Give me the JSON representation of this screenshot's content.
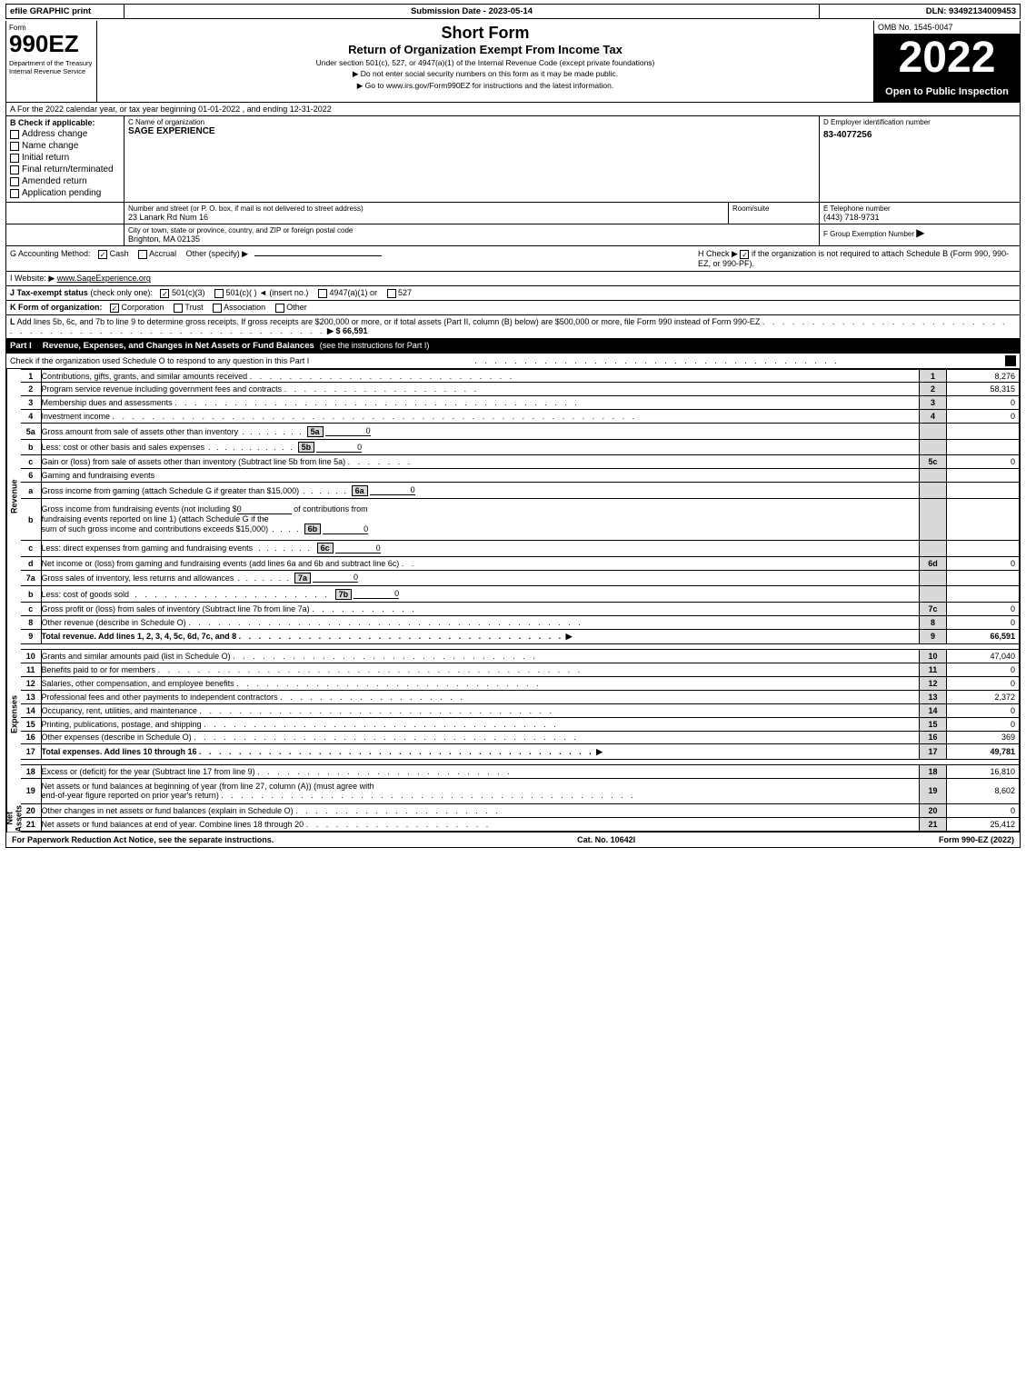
{
  "header": {
    "efile": "efile GRAPHIC print",
    "submission_label": "Submission Date - 2023-05-14",
    "dln_label": "DLN: 93492134009453"
  },
  "title": {
    "form_number": "990EZ",
    "short_form": "Short Form",
    "return_title": "Return of Organization Exempt From Income Tax",
    "subtitle": "Under section 501(c), 527, or 4947(a)(1) of the Internal Revenue Code (except private foundations)",
    "note1": "▶ Do not enter social security numbers on this form as it may be made public.",
    "note2": "▶ Go to www.irs.gov/Form990EZ for instructions and the latest information.",
    "year": "2022",
    "omb": "OMB No. 1545-0047",
    "open_label": "Open to Public Inspection",
    "dept_label": "Department of the Treasury Internal Revenue Service"
  },
  "section_a": {
    "line": "A For the 2022 calendar year, or tax year beginning 01-01-2022 , and ending 12-31-2022"
  },
  "section_b": {
    "label": "B Check if applicable:",
    "checks": [
      {
        "id": "address-change",
        "label": "Address change",
        "checked": false
      },
      {
        "id": "name-change",
        "label": "Name change",
        "checked": false
      },
      {
        "id": "initial-return",
        "label": "Initial return",
        "checked": false
      },
      {
        "id": "final-return",
        "label": "Final return/terminated",
        "checked": false
      },
      {
        "id": "amended-return",
        "label": "Amended return",
        "checked": false
      },
      {
        "id": "application-pending",
        "label": "Application pending",
        "checked": false
      }
    ]
  },
  "org": {
    "name_label": "C Name of organization",
    "name": "SAGE EXPERIENCE",
    "ein_label": "D Employer identification number",
    "ein": "83-4077256",
    "address_label": "Number and street (or P. O. box, if mail is not delivered to street address)",
    "address": "23 Lanark Rd Num 16",
    "room_label": "Room/suite",
    "room": "",
    "phone_label": "E Telephone number",
    "phone": "(443) 718-9731",
    "city_label": "City or town, state or province, country, and ZIP or foreign postal code",
    "city": "Brighton, MA  02135",
    "group_label": "F Group Exemption Number",
    "group_num": ""
  },
  "accounting": {
    "g_label": "G Accounting Method:",
    "cash_label": "Cash",
    "cash_checked": true,
    "accrual_label": "Accrual",
    "accrual_checked": false,
    "other_label": "Other (specify) ▶",
    "other_line": "____________________________",
    "h_label": "H Check ▶",
    "h_checked": true,
    "h_text": "if the organization is not required to attach Schedule B (Form 990, 990-EZ, or 990-PF)."
  },
  "website": {
    "i_label": "I Website: ▶",
    "url": "www.SageExperience.org"
  },
  "tax_exempt": {
    "j_label": "J Tax-exempt status (check only one):",
    "options": [
      {
        "id": "501c3",
        "label": "501(c)(3)",
        "checked": true
      },
      {
        "id": "501c",
        "label": "501(c)(",
        "checked": false
      },
      {
        "id": "insert",
        "label": ") ◄ (insert no.)",
        "checked": false
      },
      {
        "id": "4947a1",
        "label": "4947(a)(1) or",
        "checked": false
      },
      {
        "id": "527",
        "label": "527",
        "checked": false
      }
    ]
  },
  "form_k": {
    "k_label": "K Form of organization:",
    "options": [
      {
        "id": "corporation",
        "label": "Corporation",
        "checked": true
      },
      {
        "id": "trust",
        "label": "Trust",
        "checked": false
      },
      {
        "id": "association",
        "label": "Association",
        "checked": false
      },
      {
        "id": "other",
        "label": "Other",
        "checked": false
      }
    ]
  },
  "line_l": {
    "text": "L Add lines 5b, 6c, and 7b to line 9 to determine gross receipts. If gross receipts are $200,000 or more, or if total assets (Part II, column (B) below) are $500,000 or more, file Form 990 instead of Form 990-EZ",
    "dots": ". . . . . . . . . . . . . . . . . . . . . . . . . . . . . . . . . . . . . . . . . . . . . . . . . . . . . . . . . . .",
    "amount": "▶ $ 66,591"
  },
  "part1": {
    "label": "Part I",
    "title": "Revenue, Expenses, and Changes in Net Assets or Fund Balances",
    "instructions": "(see the instructions for Part I)",
    "check_line": "Check if the organization used Schedule O to respond to any question in this Part I",
    "check_dots": ". . . . . . . . . . . . . . . . . . . . . . . . . . . . . . . .",
    "check_checked": true
  },
  "revenue_rows": [
    {
      "num": "1",
      "desc": "Contributions, gifts, grants, and similar amounts received",
      "dots": true,
      "line_id": "1",
      "amount": "8,276"
    },
    {
      "num": "2",
      "desc": "Program service revenue including government fees and contracts",
      "dots": true,
      "line_id": "2",
      "amount": "58,315"
    },
    {
      "num": "3",
      "desc": "Membership dues and assessments",
      "dots": true,
      "line_id": "3",
      "amount": "0"
    },
    {
      "num": "4",
      "desc": "Investment income",
      "dots": true,
      "line_id": "4",
      "amount": "0"
    },
    {
      "num": "5a",
      "desc": "Gross amount from sale of assets other than inventory",
      "mid_label": "5a",
      "mid_val": "0",
      "line_id": "",
      "amount": ""
    },
    {
      "num": "b",
      "desc": "Less: cost or other basis and sales expenses",
      "mid_label": "5b",
      "mid_val": "0",
      "line_id": "",
      "amount": ""
    },
    {
      "num": "c",
      "desc": "Gain or (loss) from sale of assets other than inventory (Subtract line 5b from line 5a)",
      "dots": true,
      "line_id": "5c",
      "amount": "0"
    },
    {
      "num": "6",
      "desc": "Gaming and fundraising events",
      "dots": false,
      "line_id": "",
      "amount": ""
    },
    {
      "num": "a",
      "desc": "Gross income from gaming (attach Schedule G if greater than $15,000)",
      "mid_label": "6a",
      "mid_val": "0",
      "line_id": "",
      "amount": ""
    },
    {
      "num": "b",
      "desc": "Gross income from fundraising events (not including $ 0              of contributions from fundraising events reported on line 1) (attach Schedule G if the sum of such gross income and contributions exceeds $15,000)",
      "mid_label": "6b",
      "mid_val": "0",
      "line_id": "",
      "amount": "",
      "multiline": true
    },
    {
      "num": "c",
      "desc": "Less: direct expenses from gaming and fundraising events",
      "mid_label": "6c",
      "mid_val": "0",
      "line_id": "",
      "amount": ""
    },
    {
      "num": "d",
      "desc": "Net income or (loss) from gaming and fundraising events (add lines 6a and 6b and subtract line 6c)",
      "dots": true,
      "line_id": "6d",
      "amount": "0"
    },
    {
      "num": "7a",
      "desc": "Gross sales of inventory, less returns and allowances",
      "mid_label": "7a",
      "mid_val": "0",
      "line_id": "",
      "amount": ""
    },
    {
      "num": "b",
      "desc": "Less: cost of goods sold",
      "dots": true,
      "mid_label": "7b",
      "mid_val": "0",
      "line_id": "",
      "amount": ""
    },
    {
      "num": "c",
      "desc": "Gross profit or (loss) from sales of inventory (Subtract line 7b from line 7a)",
      "dots": true,
      "line_id": "7c",
      "amount": "0"
    },
    {
      "num": "8",
      "desc": "Other revenue (describe in Schedule O)",
      "dots": true,
      "line_id": "8",
      "amount": "0"
    },
    {
      "num": "9",
      "desc": "Total revenue. Add lines 1, 2, 3, 4, 5c, 6d, 7c, and 8",
      "dots": true,
      "bold": true,
      "arrow": true,
      "line_id": "9",
      "amount": "66,591"
    }
  ],
  "expense_rows": [
    {
      "num": "10",
      "desc": "Grants and similar amounts paid (list in Schedule O)",
      "dots": true,
      "line_id": "10",
      "amount": "47,040"
    },
    {
      "num": "11",
      "desc": "Benefits paid to or for members",
      "dots": true,
      "line_id": "11",
      "amount": "0"
    },
    {
      "num": "12",
      "desc": "Salaries, other compensation, and employee benefits",
      "dots": true,
      "line_id": "12",
      "amount": "0"
    },
    {
      "num": "13",
      "desc": "Professional fees and other payments to independent contractors",
      "dots": true,
      "line_id": "13",
      "amount": "2,372"
    },
    {
      "num": "14",
      "desc": "Occupancy, rent, utilities, and maintenance",
      "dots": true,
      "line_id": "14",
      "amount": "0"
    },
    {
      "num": "15",
      "desc": "Printing, publications, postage, and shipping",
      "dots": true,
      "line_id": "15",
      "amount": "0"
    },
    {
      "num": "16",
      "desc": "Other expenses (describe in Schedule O)",
      "dots": true,
      "line_id": "16",
      "amount": "369"
    },
    {
      "num": "17",
      "desc": "Total expenses. Add lines 10 through 16",
      "dots": true,
      "bold": true,
      "arrow": true,
      "line_id": "17",
      "amount": "49,781"
    }
  ],
  "netassets_rows": [
    {
      "num": "18",
      "desc": "Excess or (deficit) for the year (Subtract line 17 from line 9)",
      "dots": true,
      "line_id": "18",
      "amount": "16,810"
    },
    {
      "num": "19",
      "desc": "Net assets or fund balances at beginning of year (from line 27, column (A)) (must agree with end-of-year figure reported on prior year's return)",
      "dots": true,
      "line_id": "19",
      "amount": "8,602",
      "multiline": true
    },
    {
      "num": "20",
      "desc": "Other changes in net assets or fund balances (explain in Schedule O)",
      "dots": true,
      "line_id": "20",
      "amount": "0"
    },
    {
      "num": "21",
      "desc": "Net assets or fund balances at end of year. Combine lines 18 through 20",
      "dots": true,
      "line_id": "21",
      "amount": "25,412"
    }
  ],
  "footer": {
    "paperwork": "For Paperwork Reduction Act Notice, see the separate instructions.",
    "cat": "Cat. No. 10642I",
    "form_label": "Form 990-EZ (2022)"
  }
}
